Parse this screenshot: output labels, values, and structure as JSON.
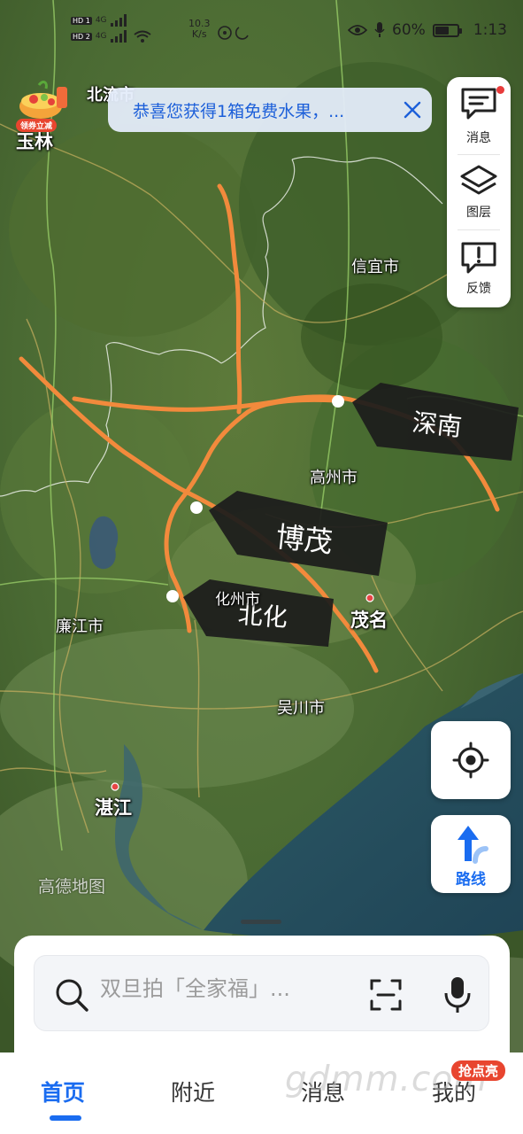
{
  "status_bar": {
    "sim1": "HD 1",
    "sim2": "HD 2",
    "net1": "4G",
    "net2": "4G",
    "speed_value": "10.3",
    "speed_unit": "K/s",
    "battery": "60%",
    "time": "1:13"
  },
  "promo_badge": {
    "label": "领券立减"
  },
  "notice": {
    "text": "恭喜您获得1箱免费水果，..."
  },
  "tools": [
    {
      "label": "消息",
      "icon": "message-icon",
      "has_dot": true
    },
    {
      "label": "图层",
      "icon": "layers-icon"
    },
    {
      "label": "反馈",
      "icon": "feedback-icon"
    }
  ],
  "map": {
    "cities": [
      {
        "name": "玉林"
      },
      {
        "name": "北流市"
      },
      {
        "name": "信宜市"
      },
      {
        "name": "高州市"
      },
      {
        "name": "化州市"
      },
      {
        "name": "茂名"
      },
      {
        "name": "廉江市"
      },
      {
        "name": "吴川市"
      },
      {
        "name": "湛江"
      }
    ],
    "route_tags": [
      {
        "label": "深南"
      },
      {
        "label": "博茂"
      },
      {
        "label": "北化"
      }
    ],
    "route_color": "#f28a3c",
    "brand": "高德地图"
  },
  "route_button": {
    "label": "路线"
  },
  "search": {
    "placeholder": "双旦拍「全家福」..."
  },
  "tabs": [
    {
      "label": "首页",
      "active": true
    },
    {
      "label": "附近"
    },
    {
      "label": "消息"
    },
    {
      "label": "我的"
    }
  ],
  "tab_badge": "抢点亮",
  "watermark": "gdmm.com",
  "colors": {
    "accent": "#1a6cf0",
    "route": "#f28a3c",
    "badge": "#e8452f"
  }
}
